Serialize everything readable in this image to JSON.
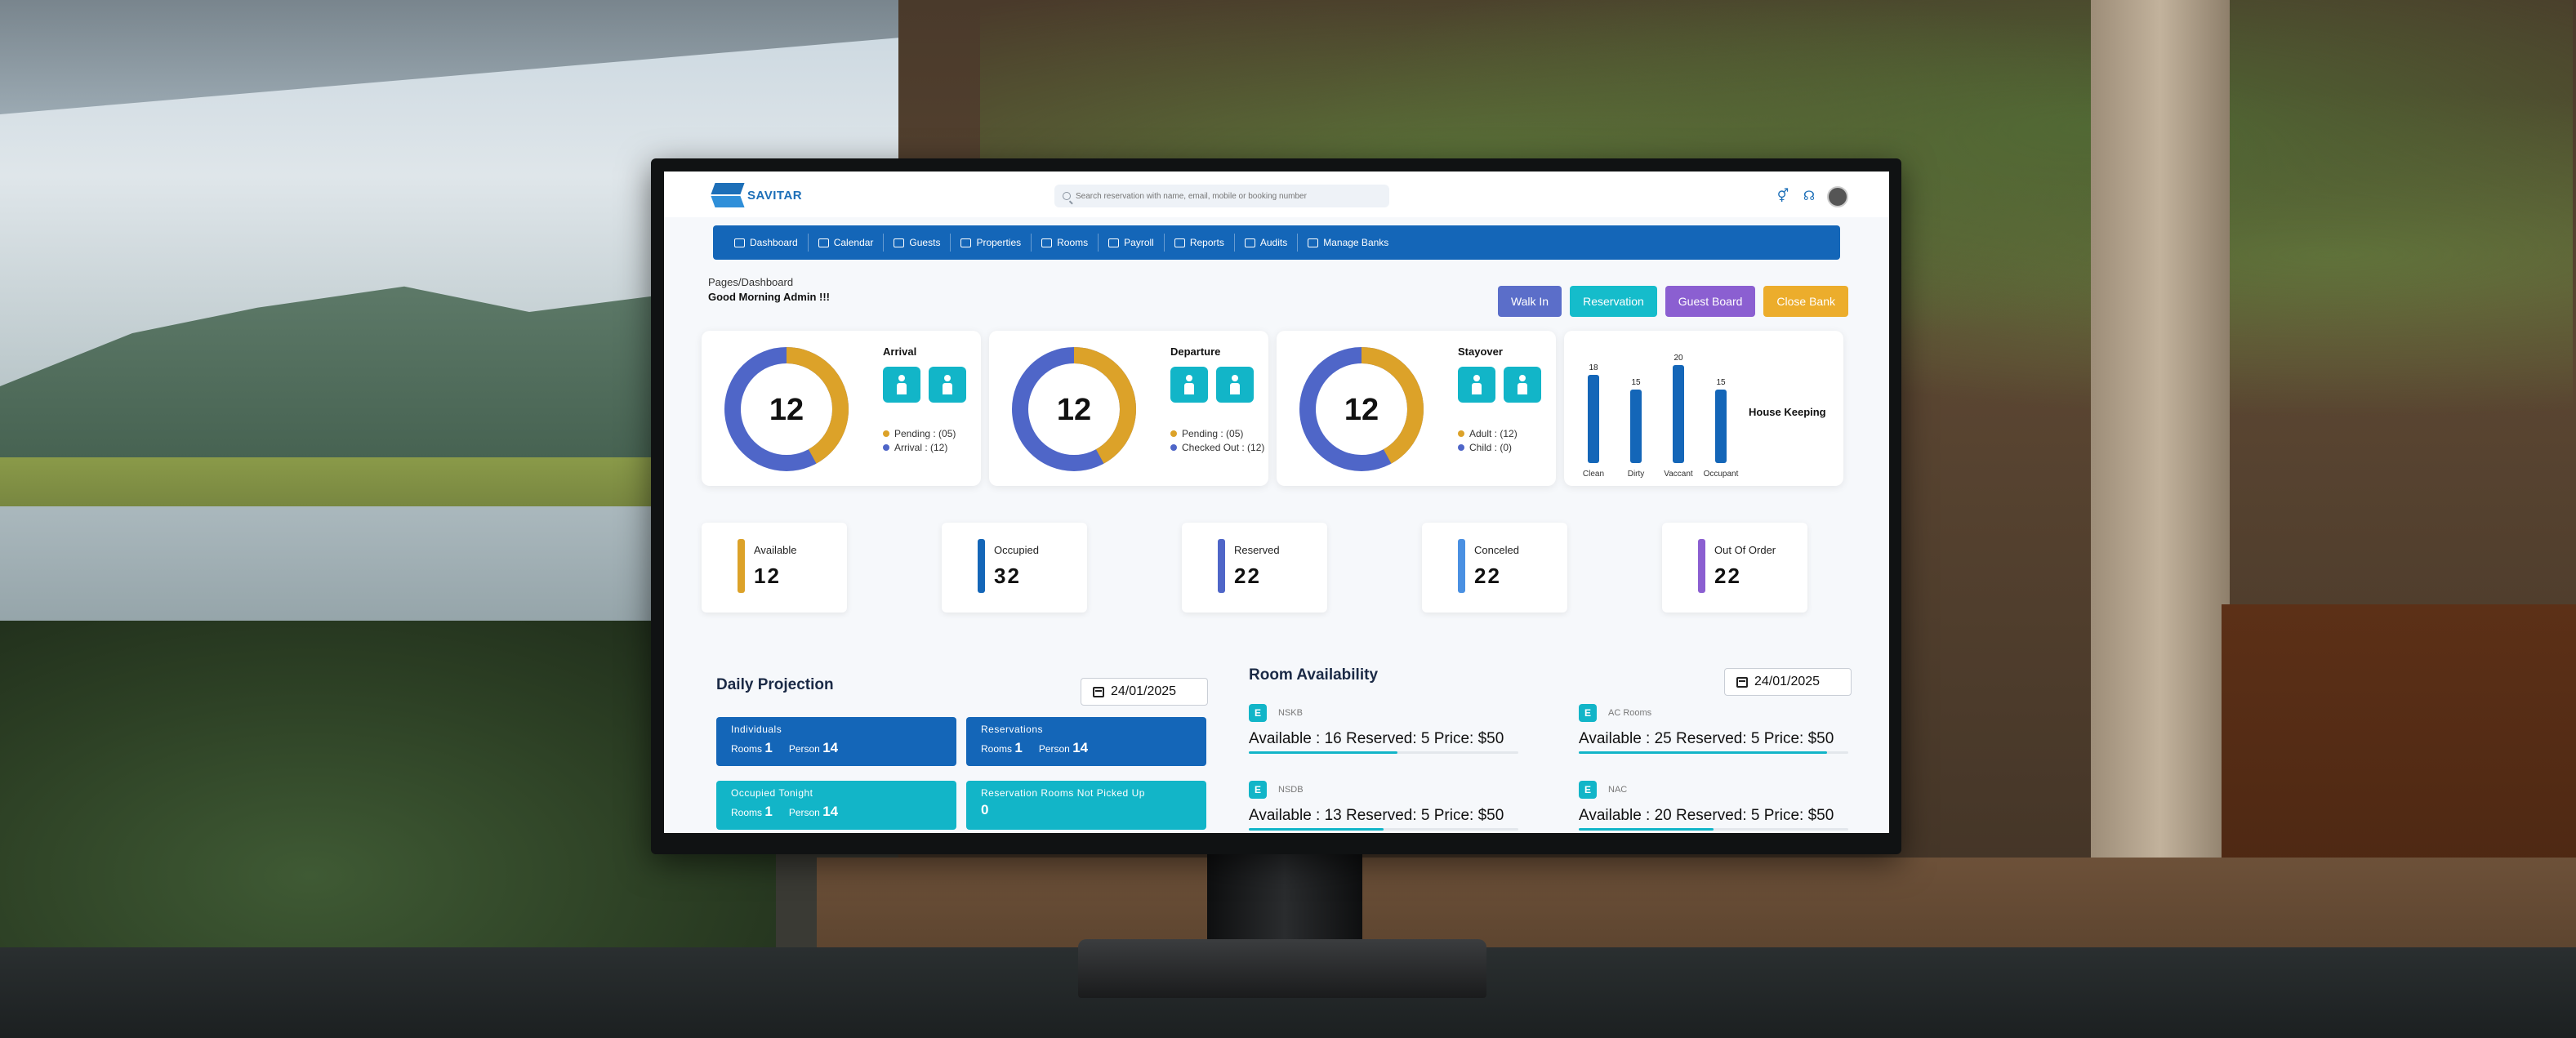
{
  "colors": {
    "brand": "#1466b8",
    "teal": "#12b5c8",
    "orange": "#dca229",
    "indigo": "#4f66c8",
    "walkin": "#5b6ec9",
    "reservation": "#15bccb",
    "guestboard": "#8b5fd1",
    "closebank": "#ecad2c"
  },
  "header": {
    "logo": "SAVITAR",
    "search_placeholder": "Search reservation with name, email, mobile or booking number"
  },
  "nav": [
    {
      "label": "Dashboard",
      "icon": "dashboard-icon"
    },
    {
      "label": "Calendar",
      "icon": "calendar-icon"
    },
    {
      "label": "Guests",
      "icon": "guests-icon"
    },
    {
      "label": "Properties",
      "icon": "properties-icon"
    },
    {
      "label": "Rooms",
      "icon": "rooms-icon"
    },
    {
      "label": "Payroll",
      "icon": "payroll-icon"
    },
    {
      "label": "Reports",
      "icon": "reports-icon"
    },
    {
      "label": "Audits",
      "icon": "audits-icon"
    },
    {
      "label": "Manage Banks",
      "icon": "banks-icon"
    }
  ],
  "page": {
    "breadcrumb": "Pages/Dashboard",
    "greeting": "Good Morning Admin !!!"
  },
  "actions": {
    "walkin": "Walk In",
    "reservation": "Reservation",
    "guestboard": "Guest Board",
    "closebank": "Close Bank"
  },
  "cards": [
    {
      "title": "Arrival",
      "total": "12",
      "orange_share": 0.42,
      "legend": [
        "Pending : (05)",
        "Arrival : (12)"
      ]
    },
    {
      "title": "Departure",
      "total": "12",
      "orange_share": 0.42,
      "legend": [
        "Pending : (05)",
        "Checked Out : (12)"
      ]
    },
    {
      "title": "Stayover",
      "total": "12",
      "orange_share": 0.42,
      "legend": [
        "Adult : (12)",
        "Child : (0)"
      ]
    }
  ],
  "chart_data": {
    "type": "bar",
    "title": "House Keeping",
    "categories": [
      "Clean",
      "Dirty",
      "Vaccant",
      "Occupant"
    ],
    "values": [
      18,
      15,
      20,
      15
    ],
    "ylim": [
      0,
      20
    ],
    "grid": false
  },
  "stats": [
    {
      "label": "Available",
      "value": "12",
      "color": "#dca229"
    },
    {
      "label": "Occupied",
      "value": "32",
      "color": "#1466b8"
    },
    {
      "label": "Reserved",
      "value": "22",
      "color": "#4f66c8"
    },
    {
      "label": "Conceled",
      "value": "22",
      "color": "#4a90e2"
    },
    {
      "label": "Out Of Order",
      "value": "22",
      "color": "#8b5fd1"
    }
  ],
  "projection": {
    "title": "Daily Projection",
    "date": "24/01/2025",
    "tiles": [
      {
        "title": "Individuals",
        "rooms_label": "Rooms",
        "rooms": "1",
        "person_label": "Person",
        "person": "14"
      },
      {
        "title": "Reservations",
        "rooms_label": "Rooms",
        "rooms": "1",
        "person_label": "Person",
        "person": "14"
      },
      {
        "title": "Occupied Tonight",
        "rooms_label": "Rooms",
        "rooms": "1",
        "person_label": "Person",
        "person": "14"
      },
      {
        "title": "Reservation Rooms Not Picked Up",
        "value": "0"
      }
    ]
  },
  "availability": {
    "title": "Room Availability",
    "date": "24/01/2025",
    "rooms": [
      {
        "badge": "E",
        "name": "NSKB",
        "line": "Available : 16  Reserved: 5  Price: $50",
        "fill": 0.55
      },
      {
        "badge": "E",
        "name": "AC Rooms",
        "line": "Available : 25  Reserved: 5  Price: $50",
        "fill": 0.92
      },
      {
        "badge": "E",
        "name": "NSDB",
        "line": "Available : 13  Reserved: 5  Price: $50",
        "fill": 0.5
      },
      {
        "badge": "E",
        "name": "NAC",
        "line": "Available : 20  Reserved: 5  Price: $50",
        "fill": 0.5
      }
    ]
  }
}
